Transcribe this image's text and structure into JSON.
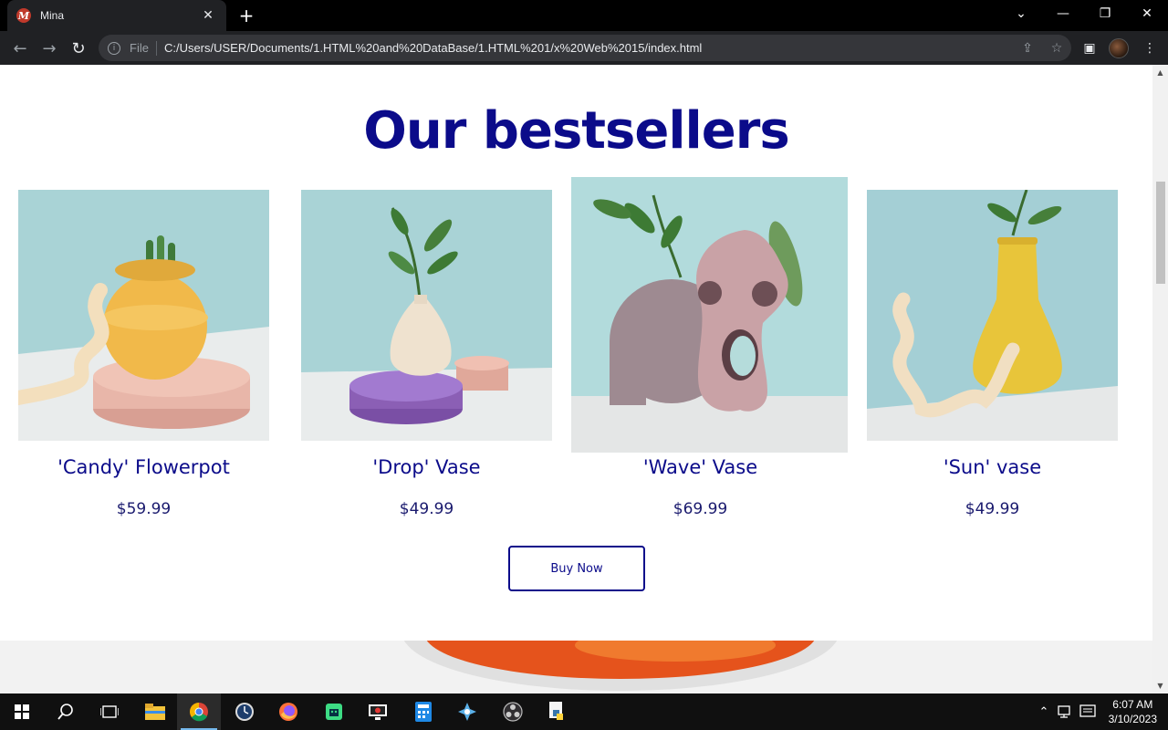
{
  "browser": {
    "tab_title": "Mina",
    "favicon_letter": "M",
    "file_label": "File",
    "url": "C:/Users/USER/Documents/1.HTML%20and%20DataBase/1.HTML%201/x%20Web%2015/index.html"
  },
  "page": {
    "section_title": "Our bestsellers",
    "products": [
      {
        "name": "'Candy' Flowerpot",
        "price": "$59.99"
      },
      {
        "name": "'Drop' Vase",
        "price": "$49.99"
      },
      {
        "name": "'Wave' Vase",
        "price": "$69.99"
      },
      {
        "name": "'Sun' vase",
        "price": "$49.99"
      }
    ],
    "buy_button": "Buy Now"
  },
  "taskbar": {
    "time": "6:07 AM",
    "date": "3/10/2023"
  },
  "colors": {
    "accent": "#0b0b8a",
    "image_bg": "#a9d3d6"
  }
}
